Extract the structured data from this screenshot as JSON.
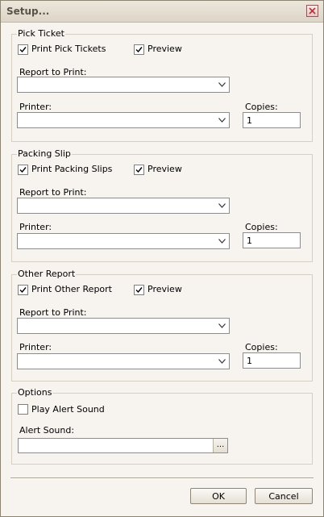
{
  "window": {
    "title": "Setup..."
  },
  "pick_ticket": {
    "legend": "Pick Ticket",
    "print_label": "Print Pick Tickets",
    "print_checked": true,
    "preview_label": "Preview",
    "preview_checked": true,
    "report_label": "Report to Print:",
    "report_value": "",
    "printer_label": "Printer:",
    "printer_value": "",
    "copies_label": "Copies:",
    "copies_value": "1"
  },
  "packing_slip": {
    "legend": "Packing Slip",
    "print_label": "Print Packing Slips",
    "print_checked": true,
    "preview_label": "Preview",
    "preview_checked": true,
    "report_label": "Report to Print:",
    "report_value": "",
    "printer_label": "Printer:",
    "printer_value": "",
    "copies_label": "Copies:",
    "copies_value": "1"
  },
  "other_report": {
    "legend": "Other Report",
    "print_label": "Print Other Report",
    "print_checked": true,
    "preview_label": "Preview",
    "preview_checked": true,
    "report_label": "Report to Print:",
    "report_value": "",
    "printer_label": "Printer:",
    "printer_value": "",
    "copies_label": "Copies:",
    "copies_value": "1"
  },
  "options": {
    "legend": "Options",
    "alert_label": "Play Alert Sound",
    "alert_checked": false,
    "sound_label": "Alert Sound:",
    "sound_value": "",
    "browse_label": "..."
  },
  "buttons": {
    "ok": "OK",
    "cancel": "Cancel"
  }
}
